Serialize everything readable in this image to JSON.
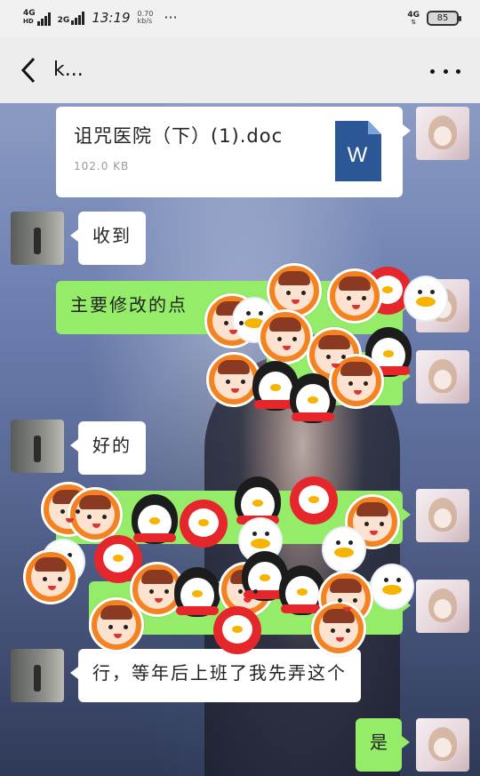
{
  "status_bar": {
    "network_1": "4G",
    "network_1_sup": "HD",
    "network_2": "2G",
    "time": "13:19",
    "speed_value": "0.70",
    "speed_unit": "kb/s",
    "menu_dots": "···",
    "network_right": "4G",
    "battery": "85"
  },
  "nav": {
    "title": "k..."
  },
  "messages": [
    {
      "side": "right",
      "type": "file",
      "file_name": "诅咒医院（下）(1).doc",
      "file_size": "102.0 KB",
      "file_icon_letter": "W"
    },
    {
      "side": "left",
      "type": "text",
      "text": "收到"
    },
    {
      "side": "right",
      "type": "text",
      "text": "主要修改的点"
    },
    {
      "side": "right",
      "type": "text",
      "text": ""
    },
    {
      "side": "left",
      "type": "text",
      "text": "好的"
    },
    {
      "side": "right",
      "type": "text",
      "text": ""
    },
    {
      "side": "right",
      "type": "text",
      "text": ""
    },
    {
      "side": "left",
      "type": "text",
      "text": "行，等年后上班了我先弄这个"
    },
    {
      "side": "right",
      "type": "text",
      "text": "是"
    }
  ],
  "colors": {
    "sent_bubble": "#95ec69",
    "received_bubble": "#ffffff",
    "doc_icon": "#2b5797"
  }
}
